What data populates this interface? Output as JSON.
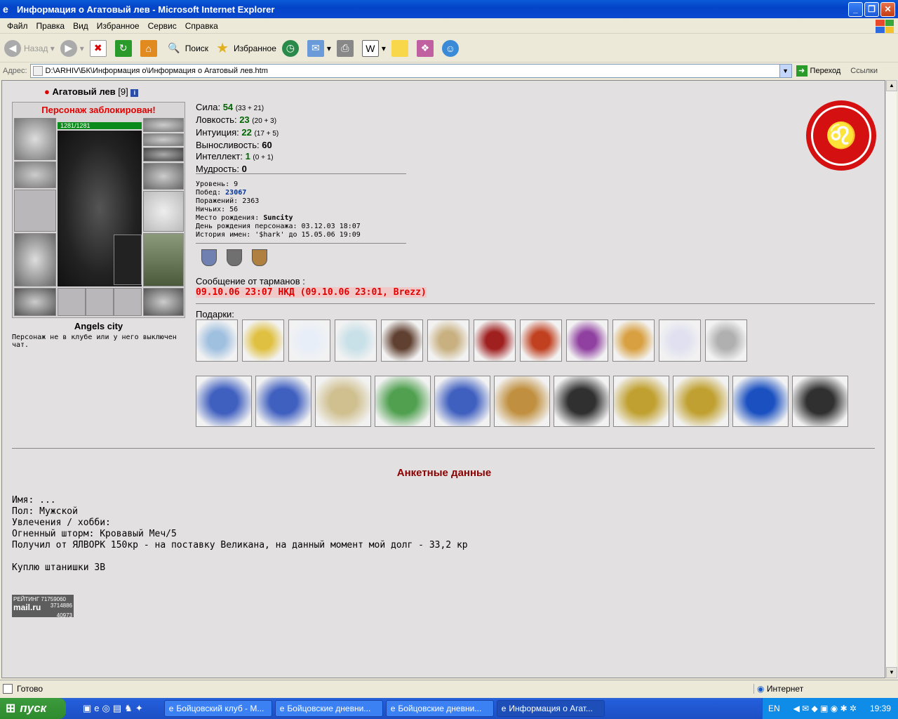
{
  "window": {
    "title": "Информация о Агатовый лев - Microsoft Internet Explorer"
  },
  "menu": [
    "Файл",
    "Правка",
    "Вид",
    "Избранное",
    "Сервис",
    "Справка"
  ],
  "toolbar": {
    "back": "Назад",
    "search": "Поиск",
    "favorites": "Избранное"
  },
  "address": {
    "label": "Адрес:",
    "value": "D:\\ARHIV\\БК\\Информация о\\Информация о Агатовый лев.htm",
    "go": "Переход",
    "links": "Ссылки"
  },
  "character": {
    "name": "Агатовый лев",
    "level": "[9]",
    "blocked": "Персонаж заблокирован!",
    "hp": "1281/1281",
    "city": "Angels city",
    "club_msg": "Персонаж не в клубе или у него выключен чат."
  },
  "stats": [
    {
      "label": "Сила:",
      "value": "54",
      "detail": "(33 + 21)"
    },
    {
      "label": "Ловкость:",
      "value": "23",
      "detail": "(20 + 3)"
    },
    {
      "label": "Интуиция:",
      "value": "22",
      "detail": "(17 + 5)"
    },
    {
      "label": "Выносливость:",
      "value": "60",
      "detail": ""
    },
    {
      "label": "Интеллект:",
      "value": "1",
      "detail": "(0 + 1)"
    },
    {
      "label": "Мудрость:",
      "value": "0",
      "detail": ""
    }
  ],
  "details": {
    "level": "Уровень: 9",
    "wins_label": "Побед:",
    "wins": "23067",
    "losses": "Поражений: 2363",
    "draws": "Ничьих: 56",
    "birthplace_label": "Место рождения:",
    "birthplace": "Suncity",
    "birthday": "День рождения персонажа: 03.12.03 18:07",
    "names": "История имен: '$hark' до 15.05.06 19:09"
  },
  "message": {
    "title": "Сообщение от тарманов :",
    "text": "09.10.06 23:07 НКД (09.10.06 23:01, Brezz)"
  },
  "gifts_label": "Подарки:",
  "gifts_row1": [
    "#a0c0e0",
    "#e0c040",
    "#e8eef8",
    "#c8e0e8",
    "#604030",
    "#c8b080",
    "#a02020",
    "#c04020",
    "#9040a0",
    "#d8a040",
    "#e0e0f0",
    "#b0b0b0"
  ],
  "gifts_row2": [
    "#4060c0",
    "#4060c0",
    "#d0c090",
    "#50a050",
    "#4060c0",
    "#c09040",
    "#303030",
    "#c0a030",
    "#c0a030",
    "#1a50c0",
    "#303030"
  ],
  "anket": {
    "title": "Анкетные данные",
    "text": "Имя: ...\nПол: Мужской\nУвлечения / хобби:\nОгненный шторм: Кровавый Меч/5\nПолучил от ЯЛВОРК 150кр - на поставку Великана, на данный момент мой долг - 33,2 кр\n\nКуплю штанишки 3В"
  },
  "rating": {
    "line1": "РЕЙТИНГ 71759060",
    "line2": "mail.ru",
    "line3": "3714886",
    "line4": "40973"
  },
  "status": {
    "text": "Готово",
    "zone": "Интернет"
  },
  "taskbar": {
    "start": "пуск",
    "tasks": [
      "Бойцовский клуб - M...",
      "Бойцовские дневни...",
      "Бойцовские дневни...",
      "Информация о Агат..."
    ],
    "lang": "EN",
    "time": "19:39"
  }
}
